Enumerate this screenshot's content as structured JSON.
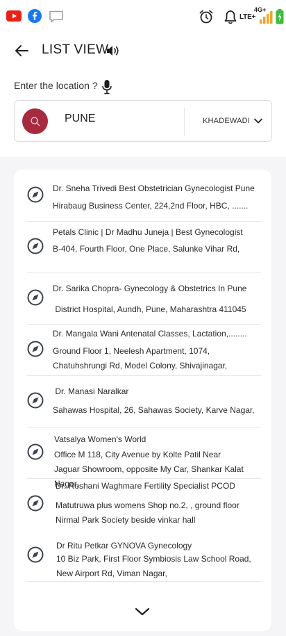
{
  "status_bar": {
    "icons": [
      "youtube-icon",
      "facebook-icon",
      "chat-icon",
      "alarm-icon",
      "bell-icon",
      "signal-icon",
      "battery-icon"
    ],
    "lte": "LTE+",
    "network": "4G+"
  },
  "header": {
    "title": "LIST VIEW",
    "location_label": "Enter the location ?"
  },
  "search": {
    "city": "PUNE",
    "area": "KHADEWADI"
  },
  "colors": {
    "accent": "#a72a3f",
    "youtube": "#e62117",
    "facebook": "#1877f2",
    "battery": "#3dbb3d",
    "signal": "#f0a52c"
  },
  "results": [
    {
      "name": "Dr. Sneha Trivedi Best Obstetrician Gynecologist Pune",
      "address": "Hirabaug Business Center, 224,2nd Floor, HBC, ......."
    },
    {
      "name": "Petals Clinic | Dr Madhu Juneja | Best Gynecologist",
      "address": "B-404, Fourth Floor, One Place, Salunke Vihar Rd,"
    },
    {
      "name": "Dr. Sarika Chopra- Gynecology & Obstetrics In Pune",
      "address": " District Hospital, Aundh, Pune, Maharashtra 411045"
    },
    {
      "name": "Dr. Mangala Wani Antenatal Classes, Lactation,........",
      "address": "Ground Floor 1, Neelesh Apartment, 1074, Chatuhshrungi Rd, Model Colony, Shivajinagar,"
    },
    {
      "name": " Dr. Manasi Naralkar",
      "address": "Sahawas Hospital, 26, Sahawas Society, Karve Nagar,"
    },
    {
      "name": "Vatsalya Women's World",
      "address": "Office M 118, City Avenue by Kolte Patil Near Jaguar Showroom, opposite My Car, Shankar Kalat Nagar,"
    },
    {
      "name": "Dr. Roshani Waghmare Fertility Specialist PCOD",
      "address": "Matutruwa plus womens Shop no.2, , ground floor Nirmal Park Society beside vinkar hall"
    },
    {
      "name": "Dr Ritu Petkar GYNOVA Gynecology",
      "address": "10 Biz Park, First Floor Symbiosis Law School Road, New Airport Rd, Viman Nagar,"
    }
  ]
}
